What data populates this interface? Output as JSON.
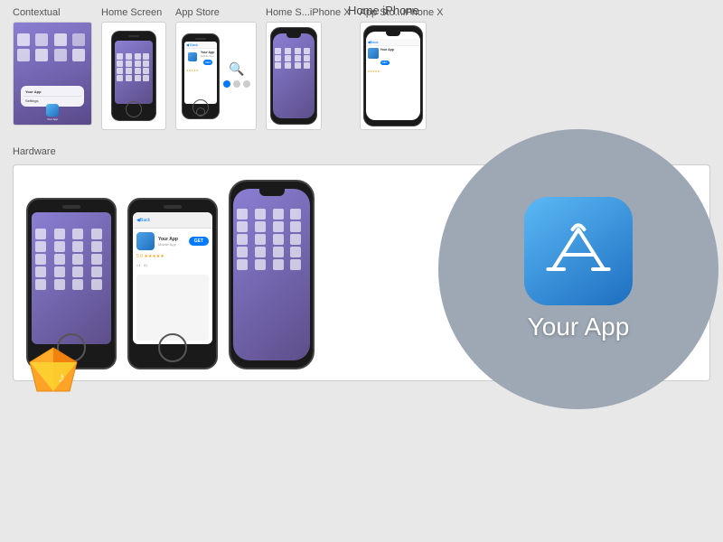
{
  "title": "Home iPhone",
  "sections": {
    "top": {
      "label": "",
      "mockups": [
        {
          "id": "contextual",
          "label": "Contextual",
          "type": "contextual"
        },
        {
          "id": "home-screen",
          "label": "Home Screen",
          "type": "home-screen"
        },
        {
          "id": "app-store",
          "label": "App Store",
          "type": "app-store"
        },
        {
          "id": "home-iphone-x",
          "label": "Home S...iPhone X",
          "type": "home-x"
        },
        {
          "id": "appstore-iphone-x",
          "label": "App Sto...iPhone X",
          "type": "appstore-x"
        }
      ]
    },
    "bottom": {
      "label": "Hardware",
      "mockups": [
        {
          "id": "hw-home",
          "type": "hw-home"
        },
        {
          "id": "hw-appstore",
          "type": "hw-appstore"
        },
        {
          "id": "hw-x",
          "type": "hw-x"
        }
      ]
    }
  },
  "app": {
    "name": "Your App",
    "icon_color_start": "#5bb8f5",
    "icon_color_end": "#1e6fc0",
    "back_label": "Back",
    "get_label": "GET",
    "rating": "5.0 ★★★★★",
    "rating_count": "=1",
    "age": "4+"
  },
  "colors": {
    "bg": "#e8e8e8",
    "card_bg": "#ffffff",
    "circle_bg": "#9da8b4",
    "iphone_body": "#1a1a1a",
    "purple_gradient_start": "#8b7fd4",
    "purple_gradient_end": "#5d4e8a"
  }
}
